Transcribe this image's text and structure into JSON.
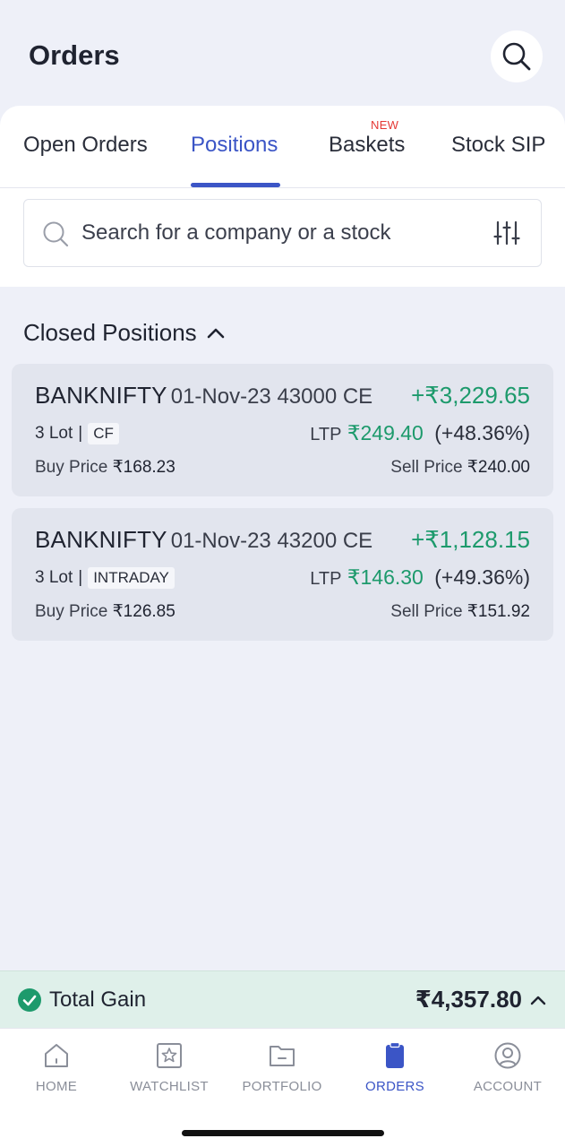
{
  "header": {
    "title": "Orders",
    "search_icon": "search-icon"
  },
  "tabs": [
    {
      "label": "Open Orders",
      "active": false
    },
    {
      "label": "Positions",
      "active": true
    },
    {
      "label": "Baskets",
      "active": false,
      "badge": "NEW"
    },
    {
      "label": "Stock SIP",
      "active": false
    }
  ],
  "search": {
    "placeholder": "Search for a company or a stock",
    "value": "",
    "filter_icon": "filter-sliders-icon"
  },
  "section": {
    "title": "Closed Positions",
    "chevron_icon": "chevron-up-icon"
  },
  "positions": [
    {
      "symbol": "BANKNIFTY",
      "contract": "01-Nov-23 43000 CE",
      "pnl": "+₹3,229.65",
      "lot": "3 Lot",
      "separator": "|",
      "product": "CF",
      "ltp_label": "LTP",
      "ltp": "₹249.40",
      "change": "(+48.36%)",
      "buy_label": "Buy Price",
      "buy_price": "₹168.23",
      "sell_label": "Sell Price",
      "sell_price": "₹240.00"
    },
    {
      "symbol": "BANKNIFTY",
      "contract": "01-Nov-23 43200 CE",
      "pnl": "+₹1,128.15",
      "lot": "3 Lot",
      "separator": "|",
      "product": "INTRADAY",
      "ltp_label": "LTP",
      "ltp": "₹146.30",
      "change": "(+49.36%)",
      "buy_label": "Buy Price",
      "buy_price": "₹126.85",
      "sell_label": "Sell Price",
      "sell_price": "₹151.92"
    }
  ],
  "total_gain": {
    "label": "Total Gain",
    "value": "₹4,357.80",
    "icon": "check-circle-icon"
  },
  "bottom_nav": [
    {
      "label": "HOME",
      "icon": "home-icon",
      "active": false
    },
    {
      "label": "WATCHLIST",
      "icon": "star-icon",
      "active": false
    },
    {
      "label": "PORTFOLIO",
      "icon": "folder-icon",
      "active": false
    },
    {
      "label": "ORDERS",
      "icon": "clipboard-icon",
      "active": true
    },
    {
      "label": "ACCOUNT",
      "icon": "user-circle-icon",
      "active": false
    }
  ],
  "colors": {
    "accent": "#3b55c6",
    "profit": "#1d9a6c",
    "badge_red": "#e53935",
    "background": "#eef0f8",
    "gain_bar": "#dff0ea"
  }
}
